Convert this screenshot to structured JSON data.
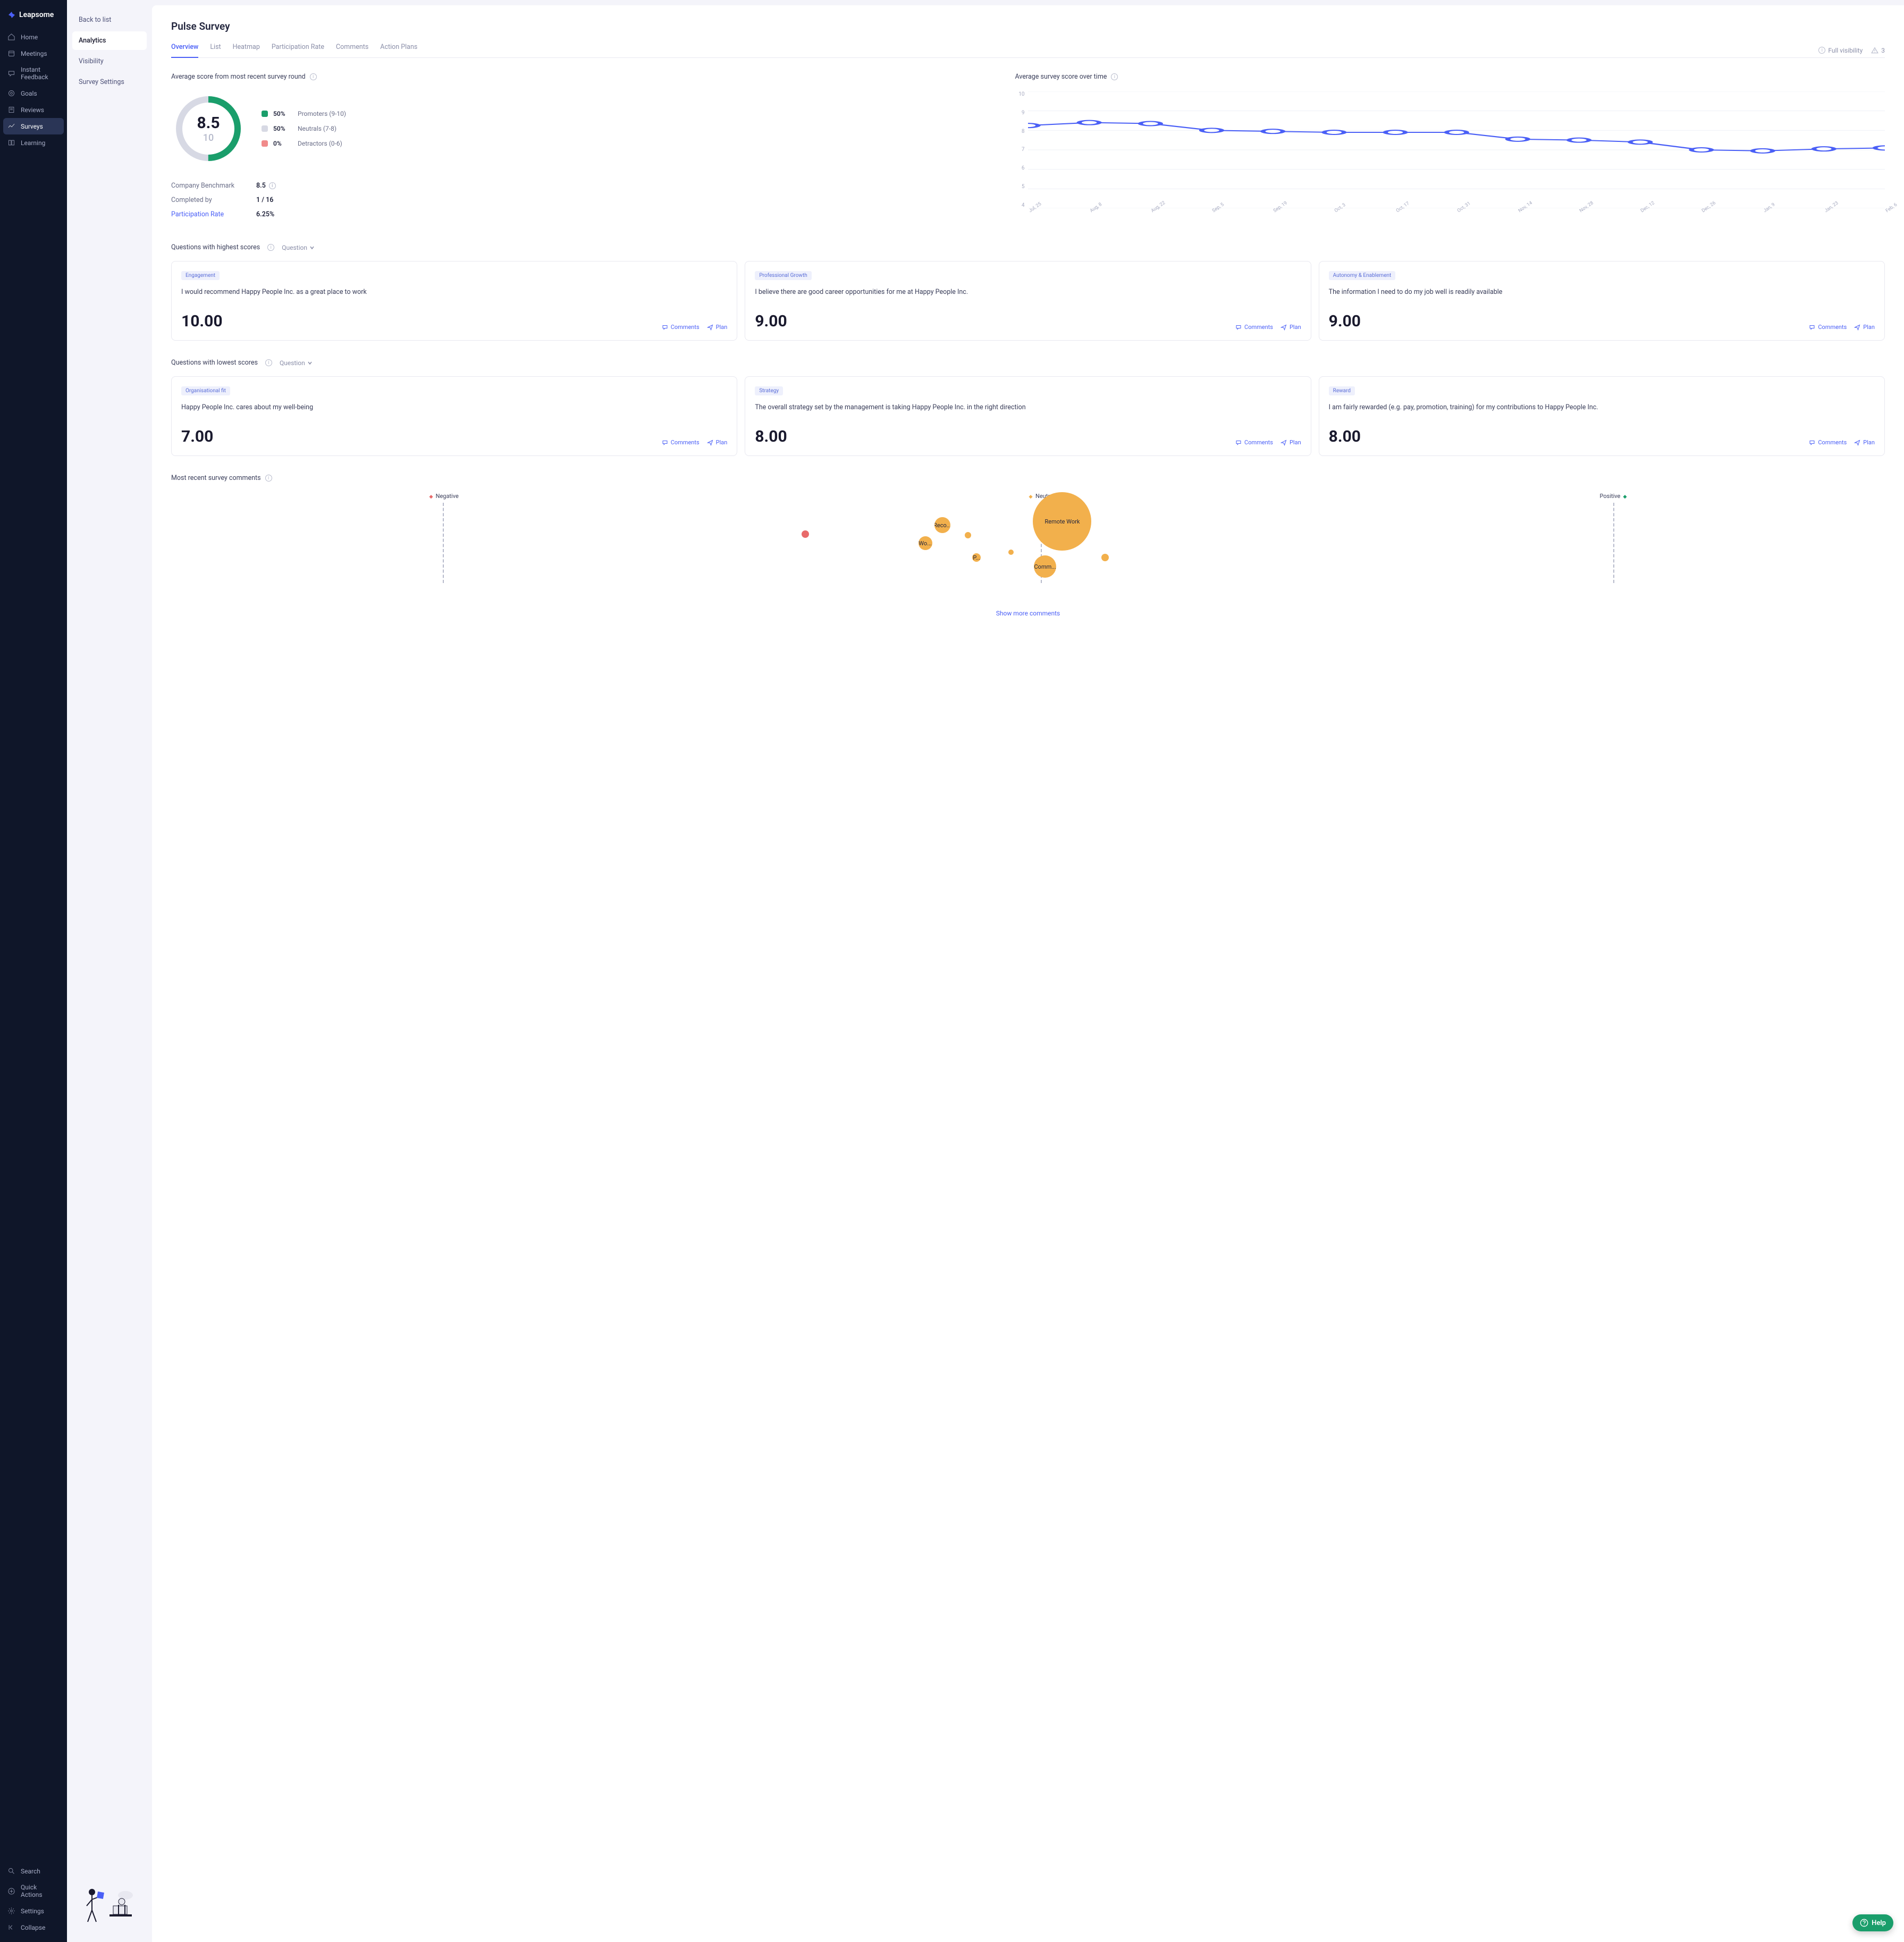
{
  "brand": "Leapsome",
  "nav": {
    "items": [
      {
        "label": "Home"
      },
      {
        "label": "Meetings"
      },
      {
        "label": "Instant Feedback"
      },
      {
        "label": "Goals"
      },
      {
        "label": "Reviews"
      },
      {
        "label": "Surveys",
        "active": true
      },
      {
        "label": "Learning"
      }
    ],
    "bottom": [
      {
        "label": "Search"
      },
      {
        "label": "Quick Actions"
      },
      {
        "label": "Settings"
      },
      {
        "label": "Collapse"
      }
    ]
  },
  "subnav": {
    "items": [
      {
        "label": "Back to list"
      },
      {
        "label": "Analytics",
        "active": true
      },
      {
        "label": "Visibility"
      },
      {
        "label": "Survey Settings"
      }
    ]
  },
  "page": {
    "title": "Pulse Survey",
    "tabs": [
      "Overview",
      "List",
      "Heatmap",
      "Participation Rate",
      "Comments",
      "Action Plans"
    ],
    "active_tab": "Overview",
    "meta": {
      "visibility": "Full visibility",
      "warning_count": "3"
    }
  },
  "avg_score": {
    "title": "Average score from most recent survey round",
    "score": "8.5",
    "max": "10",
    "legend": [
      {
        "pct": "50%",
        "label": "Promoters (9-10)",
        "color": "#1a9e6b"
      },
      {
        "pct": "50%",
        "label": "Neutrals (7-8)",
        "color": "#d7d9e4"
      },
      {
        "pct": "0%",
        "label": "Detractors (0-6)",
        "color": "#f08a8a"
      }
    ],
    "stats": [
      {
        "label": "Company Benchmark",
        "value": "8.5",
        "info": true
      },
      {
        "label": "Completed by",
        "value": "1 / 16"
      },
      {
        "label": "Participation Rate",
        "value": "6.25%",
        "link": true
      }
    ]
  },
  "chart_data": {
    "type": "line",
    "title": "Average survey score over time",
    "ylabel": "",
    "xlabel": "",
    "ylim": [
      4,
      10
    ],
    "y_ticks": [
      "10",
      "9",
      "8",
      "7",
      "6",
      "5",
      "4"
    ],
    "categories": [
      "Jul, 25",
      "Aug, 8",
      "Aug, 22",
      "Sep, 5",
      "Sep, 19",
      "Oct, 3",
      "Oct, 17",
      "Oct, 31",
      "Nov, 14",
      "Nov, 28",
      "Dec, 12",
      "Dec, 26",
      "Jan, 9",
      "Jan, 23",
      "Feb, 6"
    ],
    "values": [
      8.25,
      8.4,
      8.35,
      8.0,
      7.95,
      7.9,
      7.9,
      7.9,
      7.55,
      7.5,
      7.4,
      7.0,
      6.95,
      7.05,
      7.1
    ]
  },
  "highest": {
    "title": "Questions with highest scores",
    "dropdown": "Question",
    "cards": [
      {
        "tag": "Engagement",
        "text": "I would recommend Happy People Inc. as a great place to work",
        "score": "10.00"
      },
      {
        "tag": "Professional Growth",
        "text": "I believe there are good career opportunities for me at Happy People Inc.",
        "score": "9.00"
      },
      {
        "tag": "Autonomy & Enablement",
        "text": "The information I need to do my job well is readily available",
        "score": "9.00"
      }
    ],
    "actions": {
      "comments": "Comments",
      "plan": "Plan"
    }
  },
  "lowest": {
    "title": "Questions with lowest scores",
    "dropdown": "Question",
    "cards": [
      {
        "tag": "Organisational fit",
        "text": "Happy People Inc. cares about my well-being",
        "score": "7.00"
      },
      {
        "tag": "Strategy",
        "text": "The overall strategy set by the management is taking Happy People Inc. in the right direction",
        "score": "8.00"
      },
      {
        "tag": "Reward",
        "text": "I am fairly rewarded (e.g. pay, promotion, training) for my contributions to Happy People Inc.",
        "score": "8.00"
      }
    ]
  },
  "sentiment": {
    "title": "Most recent survey comments",
    "cols": {
      "neg": "Negative",
      "neu": "Neutral",
      "pos": "Positive"
    },
    "bubbles": [
      {
        "label": "Remote Work",
        "size": 110,
        "x": 0.52,
        "y": 0.32,
        "color": "#f2b04c"
      },
      {
        "label": "Comm...",
        "size": 42,
        "x": 0.51,
        "y": 0.82,
        "color": "#f2b04c"
      },
      {
        "label": "Reco...",
        "size": 30,
        "x": 0.45,
        "y": 0.36,
        "color": "#f2b04c"
      },
      {
        "label": "Wo...",
        "size": 26,
        "x": 0.44,
        "y": 0.56,
        "color": "#f2b04c"
      },
      {
        "label": "P...",
        "size": 16,
        "x": 0.47,
        "y": 0.72,
        "color": "#f2b04c"
      },
      {
        "label": "",
        "size": 12,
        "x": 0.465,
        "y": 0.47,
        "color": "#f2b04c"
      },
      {
        "label": "",
        "size": 10,
        "x": 0.49,
        "y": 0.66,
        "color": "#f2b04c"
      },
      {
        "label": "",
        "size": 14,
        "x": 0.545,
        "y": 0.72,
        "color": "#f2b04c"
      },
      {
        "label": "",
        "size": 14,
        "x": 0.37,
        "y": 0.46,
        "color": "#e86a6a"
      }
    ],
    "show_more": "Show more comments"
  },
  "help": "Help"
}
